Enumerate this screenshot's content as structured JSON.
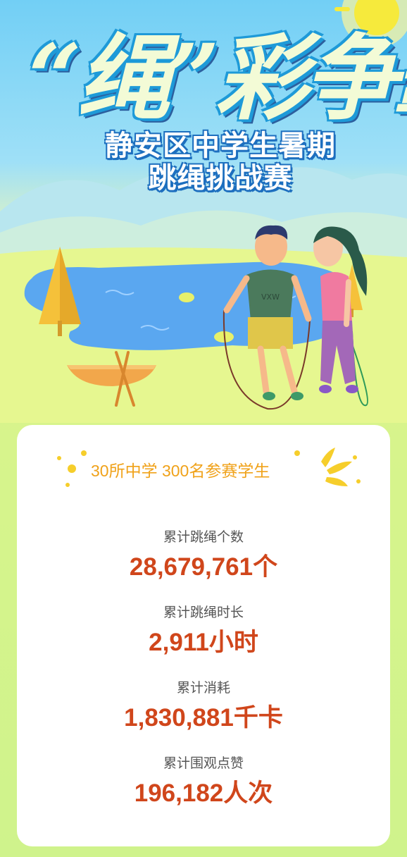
{
  "header": {
    "title_main": "“绳”彩争霸",
    "subtitle_line1": "静安区中学生暑期",
    "subtitle_line2": "跳绳挑战赛",
    "shirt_text": "VXW"
  },
  "summary": {
    "highlight": "30所中学 300名参赛学生"
  },
  "stats": [
    {
      "label": "累计跳绳个数",
      "value": "28,679,761个"
    },
    {
      "label": "累计跳绳时长",
      "value": "2,911小时"
    },
    {
      "label": "累计消耗",
      "value": "1,830,881千卡"
    },
    {
      "label": "累计围观点赞",
      "value": "196,182人次"
    }
  ],
  "colors": {
    "sky": "#72cff5",
    "grass": "#d8f48c",
    "lake": "#5aa7f0",
    "highlight_text": "#f0a21a",
    "stat_value": "#d0461b",
    "stat_label": "#555555"
  }
}
